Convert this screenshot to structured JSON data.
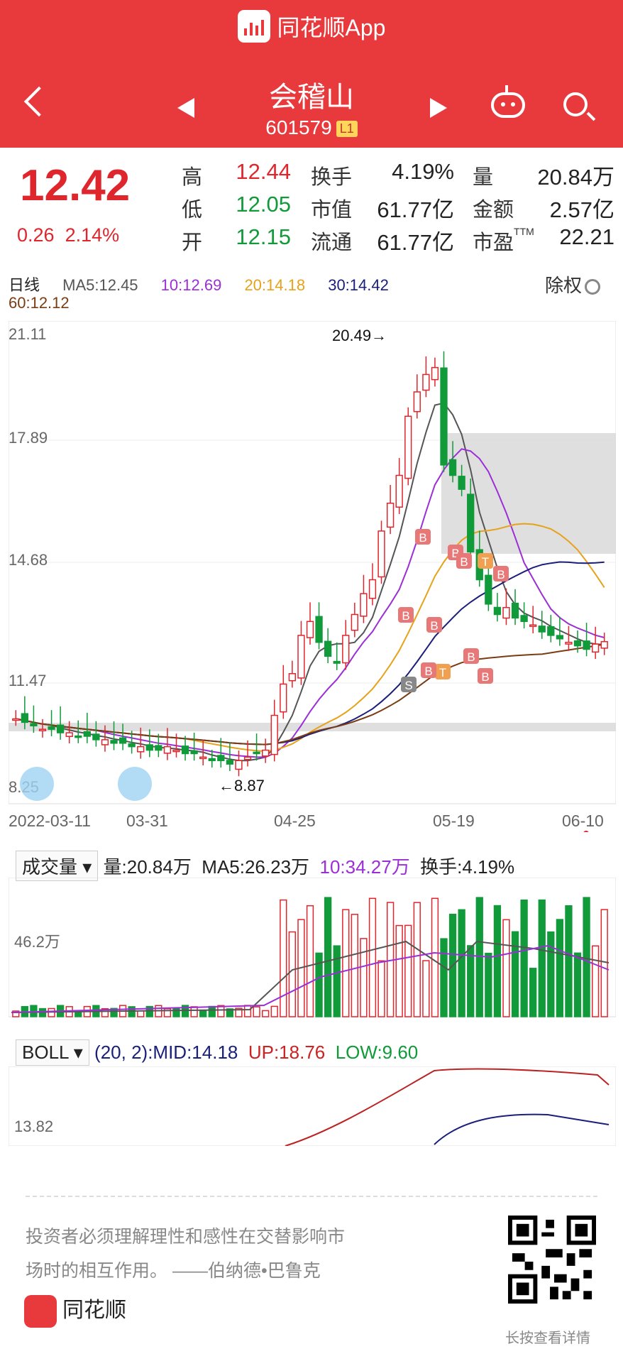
{
  "app": {
    "title": "同花顺App"
  },
  "stock": {
    "name": "会稽山",
    "code": "601579",
    "level": "L1"
  },
  "quote": {
    "price": "12.42",
    "change": "0.26",
    "change_pct": "2.14%",
    "labels": {
      "high": "高",
      "low": "低",
      "open": "开",
      "turnover": "换手",
      "mktcap": "市值",
      "float": "流通",
      "volume": "量",
      "amount": "金额",
      "pe": "市盈",
      "pe_sup": "TTM"
    },
    "values": {
      "high": "12.44",
      "low": "12.05",
      "open": "12.15",
      "turnover": "4.19%",
      "mktcap": "61.77亿",
      "float": "61.77亿",
      "volume": "20.84万",
      "amount": "2.57亿",
      "pe": "22.21"
    }
  },
  "ma_bar": {
    "period": "日线",
    "ma5": "MA5:12.45",
    "ma10": "10:12.69",
    "ma20": "20:14.18",
    "ma30": "30:14.42",
    "ma60": "60:12.12",
    "fuquan": "除权"
  },
  "kline": {
    "y_labels": [
      "21.11",
      "17.89",
      "14.68",
      "11.47",
      "8.25"
    ],
    "x_labels": [
      "2022-03-11",
      "03-31",
      "04-25",
      "05-19",
      "06-10"
    ],
    "high_marker": "20.49→",
    "low_marker": "←8.87",
    "signals": [
      "B",
      "B",
      "B",
      "T",
      "B",
      "B",
      "B",
      "B",
      "T",
      "B",
      "B",
      "S"
    ]
  },
  "volume_panel": {
    "selector": "成交量",
    "vol": "量:20.84万",
    "ma5": "MA5:26.23万",
    "ma10": "10:34.27万",
    "turnover": "换手:4.19%",
    "y_label": "46.2万"
  },
  "boll_panel": {
    "selector": "BOLL",
    "params": "(20, 2):",
    "mid": "MID:14.18",
    "up": "UP:18.76",
    "low": "LOW:9.60",
    "y_label": "13.82"
  },
  "footer": {
    "quote_line1": "投资者必须理解理性和感性在交替影响市",
    "quote_line2": "场时的相互作用。 ——伯纳德•巴鲁克",
    "brand": "同花顺",
    "qr_label": "长按查看详情"
  },
  "colors": {
    "up": "#e0262d",
    "down": "#109a3a",
    "ma5": "#555555",
    "ma10": "#9b2fd6",
    "ma20": "#e6a21a",
    "ma30": "#1a1f7a",
    "ma60": "#7a3d13"
  }
}
